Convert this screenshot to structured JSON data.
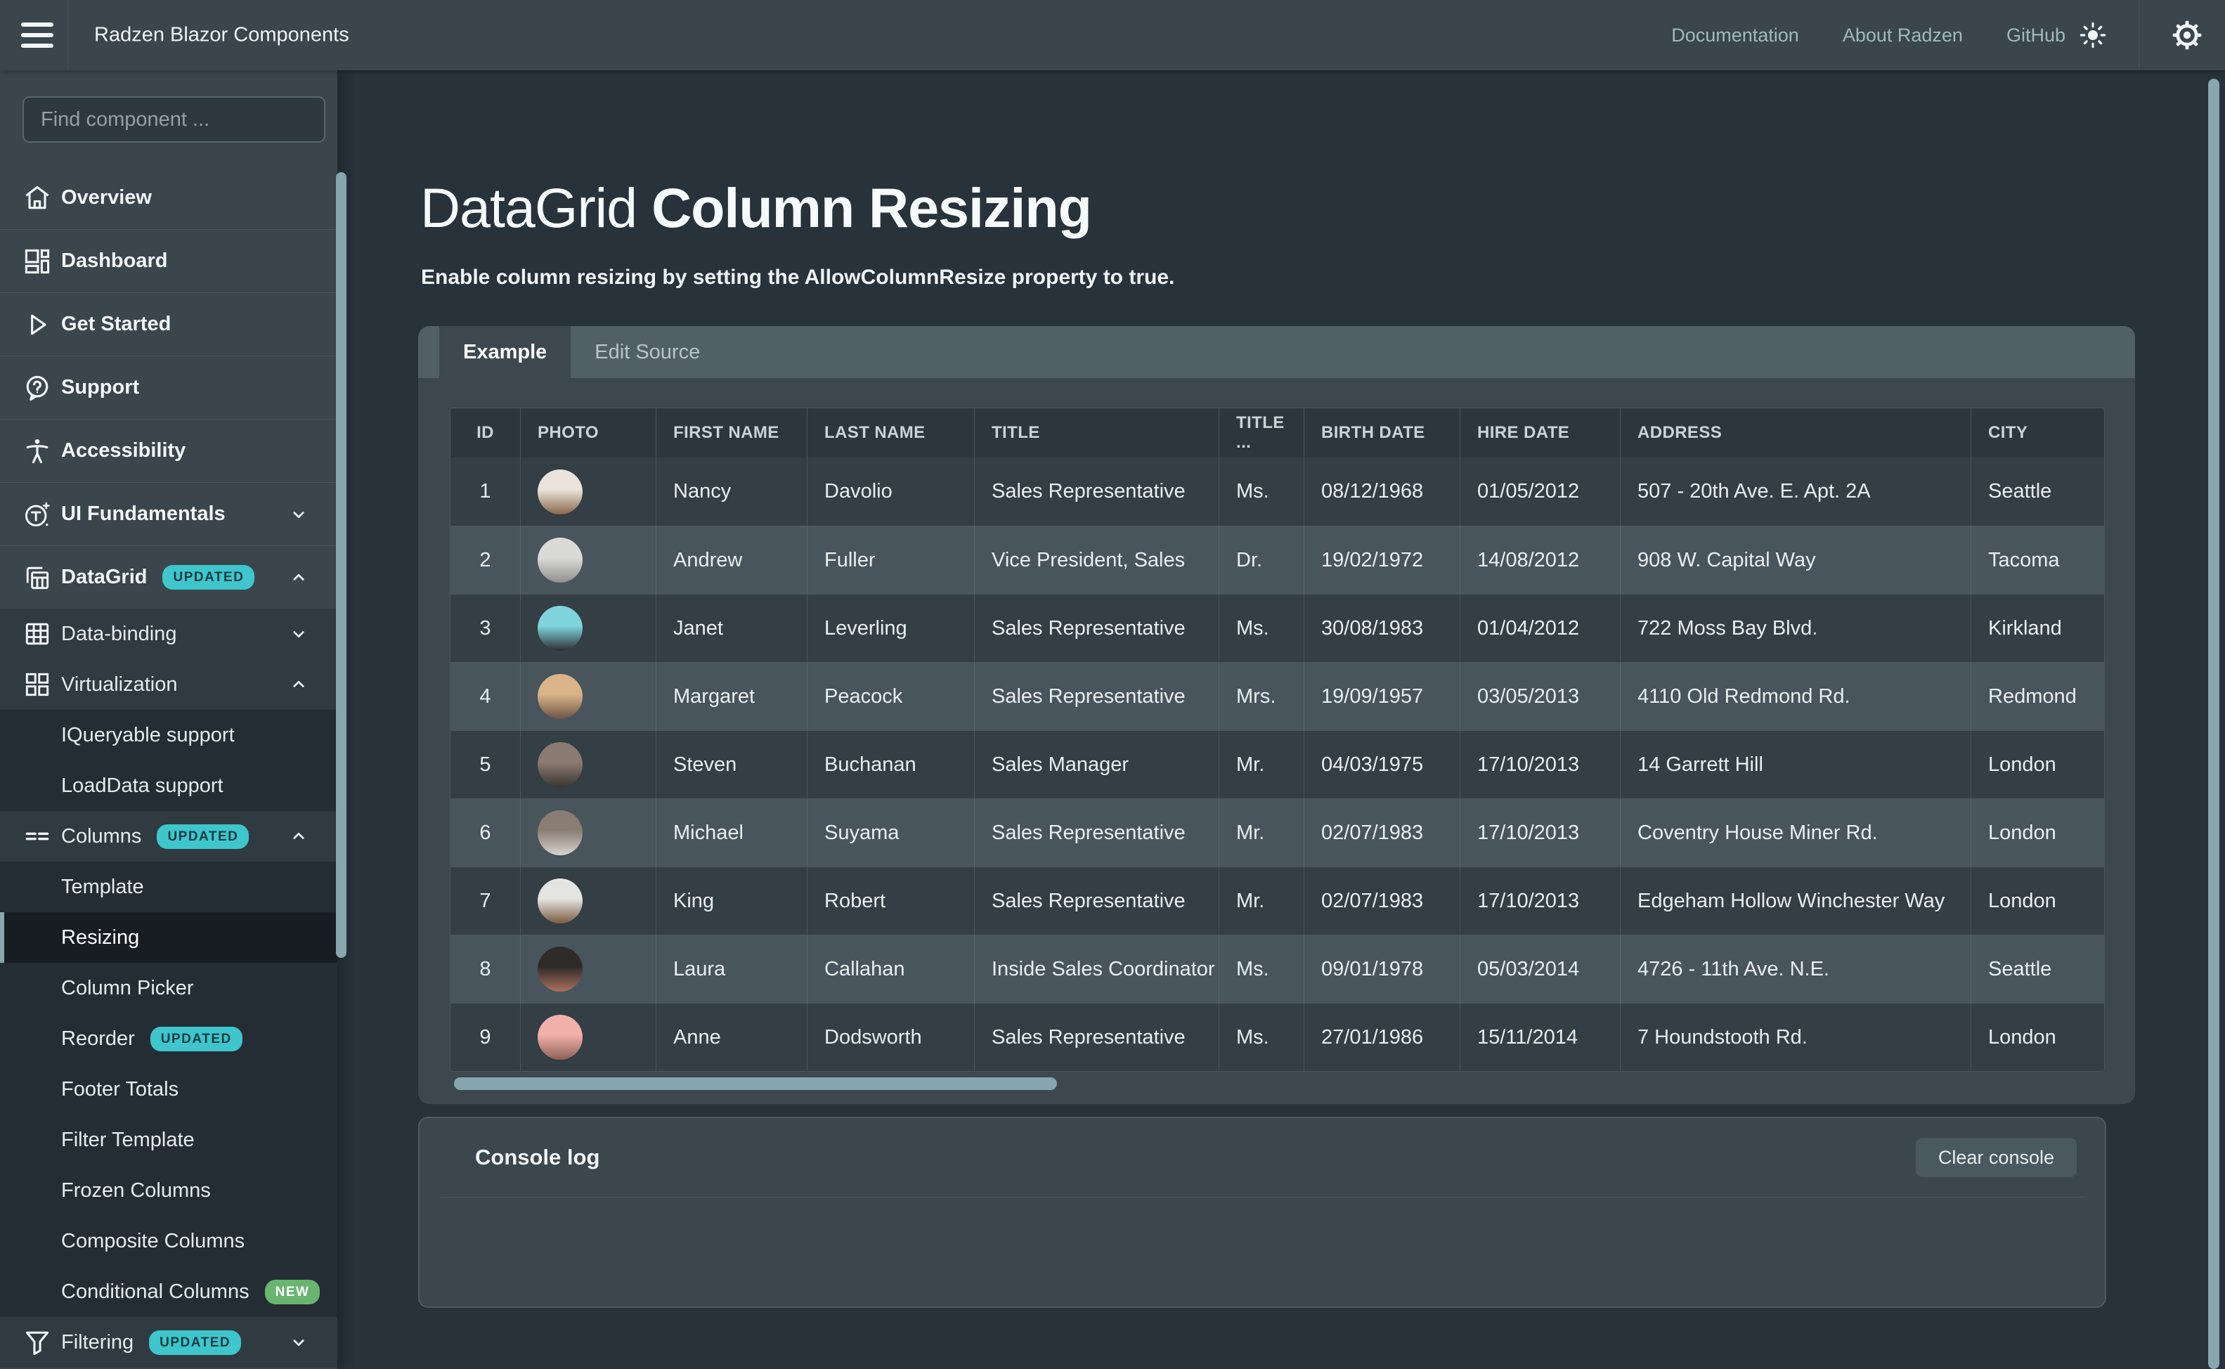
{
  "navbar": {
    "title": "Radzen Blazor Components",
    "links": [
      "Documentation",
      "About Radzen",
      "GitHub"
    ]
  },
  "sidebar": {
    "search": {
      "placeholder": "Find component ..."
    },
    "items": [
      {
        "label": "Overview",
        "icon": "home-icon"
      },
      {
        "label": "Dashboard",
        "icon": "dashboard-icon"
      },
      {
        "label": "Get Started",
        "icon": "play-icon"
      },
      {
        "label": "Support",
        "icon": "help-icon"
      },
      {
        "label": "Accessibility",
        "icon": "accessibility-icon"
      },
      {
        "label": "UI Fundamentals",
        "icon": "typography-icon",
        "chevron": "down"
      },
      {
        "label": "DataGrid",
        "icon": "datagrid-icon",
        "badge": "UPDATED",
        "chevron": "up"
      },
      {
        "label": "Data-binding",
        "icon": "table-icon",
        "chevron": "down"
      },
      {
        "label": "Virtualization",
        "icon": "grid-icon",
        "chevron": "up"
      },
      {
        "label": "IQueryable support"
      },
      {
        "label": "LoadData support"
      },
      {
        "label": "Columns",
        "icon": "columns-icon",
        "badge": "UPDATED",
        "chevron": "up"
      },
      {
        "label": "Template"
      },
      {
        "label": "Resizing",
        "selected": true
      },
      {
        "label": "Column Picker"
      },
      {
        "label": "Reorder",
        "badge": "UPDATED"
      },
      {
        "label": "Footer Totals"
      },
      {
        "label": "Filter Template"
      },
      {
        "label": "Frozen Columns"
      },
      {
        "label": "Composite Columns"
      },
      {
        "label": "Conditional Columns",
        "badge": "NEW"
      },
      {
        "label": "Filtering",
        "icon": "filter-icon",
        "badge": "UPDATED",
        "chevron": "down"
      }
    ]
  },
  "main": {
    "title_light": "DataGrid ",
    "title_bold": "Column Resizing",
    "subtitle": "Enable column resizing by setting the AllowColumnResize property to true.",
    "tabs": [
      {
        "label": "Example"
      },
      {
        "label": "Edit Source"
      }
    ]
  },
  "table": {
    "columns": [
      "ID",
      "PHOTO",
      "FIRST NAME",
      "LAST NAME",
      "TITLE",
      "TITLE ...",
      "BIRTH DATE",
      "HIRE DATE",
      "ADDRESS",
      "CITY"
    ],
    "rows": [
      {
        "id": "1",
        "first_name": "Nancy",
        "last_name": "Davolio",
        "title": "Sales Representative",
        "title_of_courtesy": "Ms.",
        "birth_date": "08/12/1968",
        "hire_date": "01/05/2012",
        "address": "507 - 20th Ave. E. Apt. 2A",
        "city": "Seattle",
        "avatar": [
          "#e9e3db",
          "#8a6748"
        ]
      },
      {
        "id": "2",
        "first_name": "Andrew",
        "last_name": "Fuller",
        "title": "Vice President, Sales",
        "title_of_courtesy": "Dr.",
        "birth_date": "19/02/1972",
        "hire_date": "14/08/2012",
        "address": "908 W. Capital Way",
        "city": "Tacoma",
        "avatar": [
          "#d9d9d7",
          "#8f8f8d"
        ]
      },
      {
        "id": "3",
        "first_name": "Janet",
        "last_name": "Leverling",
        "title": "Sales Representative",
        "title_of_courtesy": "Ms.",
        "birth_date": "30/08/1983",
        "hire_date": "01/04/2012",
        "address": "722 Moss Bay Blvd.",
        "city": "Kirkland",
        "avatar": [
          "#7fd4dc",
          "#2b2f31"
        ]
      },
      {
        "id": "4",
        "first_name": "Margaret",
        "last_name": "Peacock",
        "title": "Sales Representative",
        "title_of_courtesy": "Mrs.",
        "birth_date": "19/09/1957",
        "hire_date": "03/05/2013",
        "address": "4110 Old Redmond Rd.",
        "city": "Redmond",
        "avatar": [
          "#d8b488",
          "#6d5444"
        ]
      },
      {
        "id": "5",
        "first_name": "Steven",
        "last_name": "Buchanan",
        "title": "Sales Manager",
        "title_of_courtesy": "Mr.",
        "birth_date": "04/03/1975",
        "hire_date": "17/10/2013",
        "address": "14 Garrett Hill",
        "city": "London",
        "avatar": [
          "#8b7a72",
          "#3a3532"
        ]
      },
      {
        "id": "6",
        "first_name": "Michael",
        "last_name": "Suyama",
        "title": "Sales Representative",
        "title_of_courtesy": "Mr.",
        "birth_date": "02/07/1983",
        "hire_date": "17/10/2013",
        "address": "Coventry House Miner Rd.",
        "city": "London",
        "avatar": [
          "#8a7d74",
          "#d9d5d0"
        ]
      },
      {
        "id": "7",
        "first_name": "King",
        "last_name": "Robert",
        "title": "Sales Representative",
        "title_of_courtesy": "Mr.",
        "birth_date": "02/07/1983",
        "hire_date": "17/10/2013",
        "address": "Edgeham Hollow Winchester Way",
        "city": "London",
        "avatar": [
          "#e4e4e2",
          "#7a5a42"
        ]
      },
      {
        "id": "8",
        "first_name": "Laura",
        "last_name": "Callahan",
        "title": "Inside Sales Coordinator",
        "title_of_courtesy": "Ms.",
        "birth_date": "09/01/1978",
        "hire_date": "05/03/2014",
        "address": "4726 - 11th Ave. N.E.",
        "city": "Seattle",
        "avatar": [
          "#2e2b29",
          "#b0705e"
        ]
      },
      {
        "id": "9",
        "first_name": "Anne",
        "last_name": "Dodsworth",
        "title": "Sales Representative",
        "title_of_courtesy": "Ms.",
        "birth_date": "27/01/1986",
        "hire_date": "15/11/2014",
        "address": "7 Houndstooth Rd.",
        "city": "London",
        "avatar": [
          "#f2b0aa",
          "#8d6055"
        ]
      }
    ]
  },
  "console": {
    "title": "Console log",
    "clear_label": "Clear console"
  },
  "colors": {
    "accent_scrollbar": "#87a6ae",
    "badge_updated": "#3ec6cc",
    "badge_new": "#67b56e",
    "navbar_bg": "#3a464c",
    "main_bg": "#28323a",
    "card_bg": "#3d484e"
  }
}
